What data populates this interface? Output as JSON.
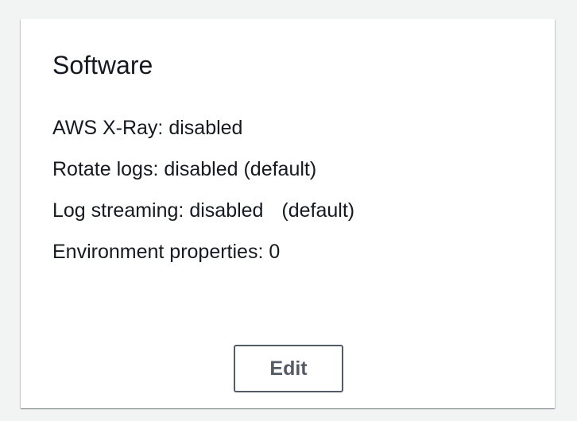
{
  "card": {
    "title": "Software",
    "properties": [
      {
        "label": "AWS X-Ray:",
        "value": "disabled",
        "note": ""
      },
      {
        "label": "Rotate logs:",
        "value": "disabled",
        "note": "(default)"
      },
      {
        "label": "Log streaming:",
        "value": "disabled",
        "note": "(default)"
      },
      {
        "label": "Environment properties:",
        "value": "0",
        "note": ""
      }
    ],
    "edit_label": "Edit"
  },
  "colors": {
    "background": "#f2f3f3",
    "card": "#ffffff",
    "text": "#16191f",
    "button_border": "#545b64"
  }
}
